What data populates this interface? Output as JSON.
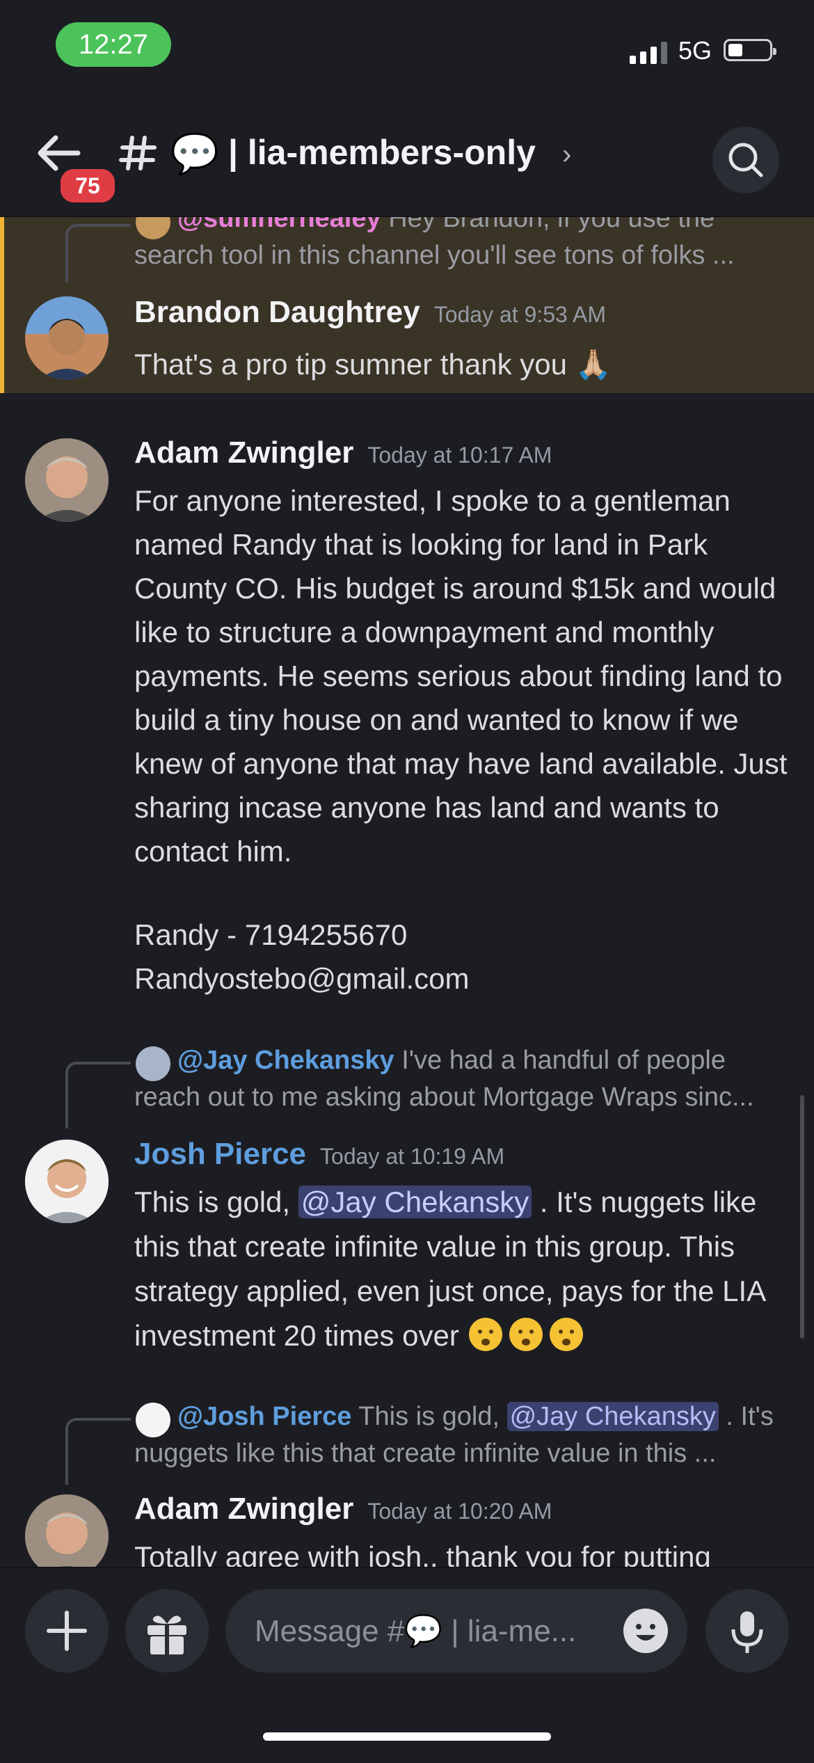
{
  "status_bar": {
    "time": "12:27",
    "network": "5G",
    "battery_level": 0.35
  },
  "header": {
    "back_badge": "75",
    "channel_emoji": "💬",
    "channel_name": "| lia-members-only",
    "chevron": "›"
  },
  "messages": [
    {
      "reply": {
        "mention": "@sumnerhealey",
        "text": "Hey Brandon, if you use the search tool in this channel you'll see tons of folks ..."
      },
      "author": "Brandon Daughtrey",
      "time": "Today at 9:53 AM",
      "text": "That's a pro tip sumner thank you",
      "emoji": "🙏🏼",
      "highlighted": true
    },
    {
      "author": "Adam Zwingler",
      "time": "Today at 10:17 AM",
      "text": "For anyone interested, I spoke to a gentleman named Randy that is looking for land in Park County CO. His budget is around $15k and would like to structure a downpayment and monthly payments. He seems serious about finding land to build a tiny house on and wanted to know if we knew of anyone that may have land available. Just sharing incase anyone has land and wants to contact him.",
      "contact_name": "Randy - 7194255670",
      "contact_email": "Randyostebo@gmail.com"
    },
    {
      "reply": {
        "mention": "@Jay Chekansky",
        "text": "I've had a handful of people reach out to me asking about Mortgage Wraps sinc..."
      },
      "author": "Josh Pierce",
      "author_color": "#5e9ede",
      "time": "Today at 10:19 AM",
      "text_before": "This is gold, ",
      "mention": "@Jay Chekansky",
      "text_after": " . It's nuggets like this that create infinite value in this group. This strategy applied, even just once, pays for the LIA investment 20 times over"
    },
    {
      "reply": {
        "mention": "@Josh Pierce",
        "text_before": "This is gold, ",
        "inner_mention": "@Jay Chekansky",
        "text_after": " . It's nuggets like this that create infinite value in this ..."
      },
      "author": "Adam Zwingler",
      "time": "Today at 10:20 AM",
      "text": "Totally agree with josh., thank you for putting"
    }
  ],
  "composer": {
    "placeholder_prefix": "Message #",
    "placeholder_emoji": "💬",
    "placeholder_suffix": " | lia-me..."
  },
  "icons": [
    "back-arrow-icon",
    "hashtag-icon",
    "search-icon",
    "plus-icon",
    "gift-icon",
    "smiley-icon",
    "microphone-icon"
  ],
  "colors": {
    "background": "#1c1d22",
    "highlight_bg": "#3a3427",
    "highlight_bar": "#f0b232",
    "mention_bg": "#3c4270",
    "sumner_mention": "#e77ed8",
    "blue_mention": "#5e9ede",
    "badge": "#e03c44",
    "time_pill": "#4cc35a"
  }
}
